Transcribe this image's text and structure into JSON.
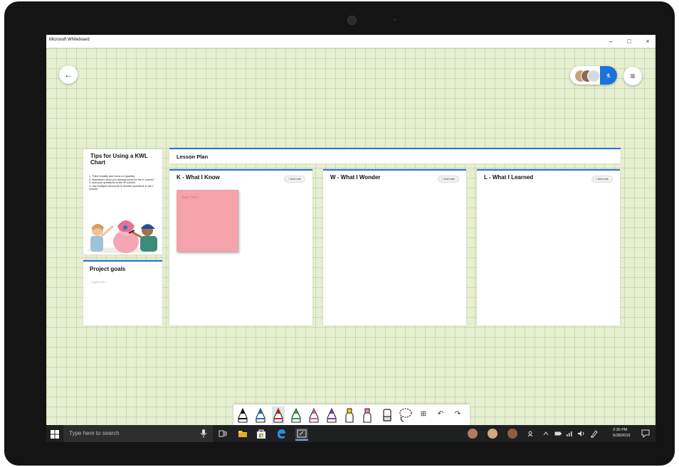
{
  "window": {
    "title": "Microsoft Whiteboard",
    "minimize_glyph": "–",
    "maximize_glyph": "□",
    "close_glyph": "×"
  },
  "canvas_controls": {
    "back_icon": "arrow-left-icon",
    "back_glyph": "←",
    "menu_icon": "hamburger-menu-icon",
    "menu_glyph": "≡",
    "invite_glyph": "ዿ",
    "invite_icon": "person-add-icon"
  },
  "tips": {
    "title": "Tips for Using a KWL Chart",
    "items": [
      "1. Think broadly and focus on quantity",
      "2. Brainstorm what you already know for the K column",
      "3. Add your questions to the W column",
      "4. Use multiple resources to answer questions in the L column"
    ]
  },
  "project_goals": {
    "title": "Project goals",
    "placeholder": "•  Type here..."
  },
  "lesson_plan": {
    "title": "Lesson Plan"
  },
  "columns": [
    {
      "title": "K - What I Know",
      "add_label": "+  Add note"
    },
    {
      "title": "W - What I Wonder",
      "add_label": "+  Add note"
    },
    {
      "title": "L - What I Learned",
      "add_label": "+  Add note"
    }
  ],
  "sticky_note": {
    "placeholder": "Type here...",
    "color": "#f4a3ab"
  },
  "toolbar": {
    "tools": [
      {
        "name": "black-pen",
        "color": "#111111"
      },
      {
        "name": "blue-pen",
        "color": "#1f6fd6"
      },
      {
        "name": "red-pen",
        "color": "#d32020",
        "selected": true
      },
      {
        "name": "green-pen",
        "color": "#2e9c4a"
      },
      {
        "name": "pink-pen",
        "color": "#e0559a"
      },
      {
        "name": "purple-pen",
        "color": "#7a3cb8"
      },
      {
        "name": "yellow-highlighter",
        "color": "#f5d000"
      },
      {
        "name": "pink-highlighter",
        "color": "#f07fb5"
      }
    ],
    "glyphs": {
      "ruler": "⊞",
      "undo": "↶",
      "redo": "↷"
    }
  },
  "taskbar": {
    "search_placeholder": "Type here to search",
    "time": "2:30 PM",
    "date": "5/28/2019"
  },
  "colors": {
    "accent": "#1f77d1",
    "canvas": "#e6efd1",
    "taskbar": "#1f2022"
  }
}
